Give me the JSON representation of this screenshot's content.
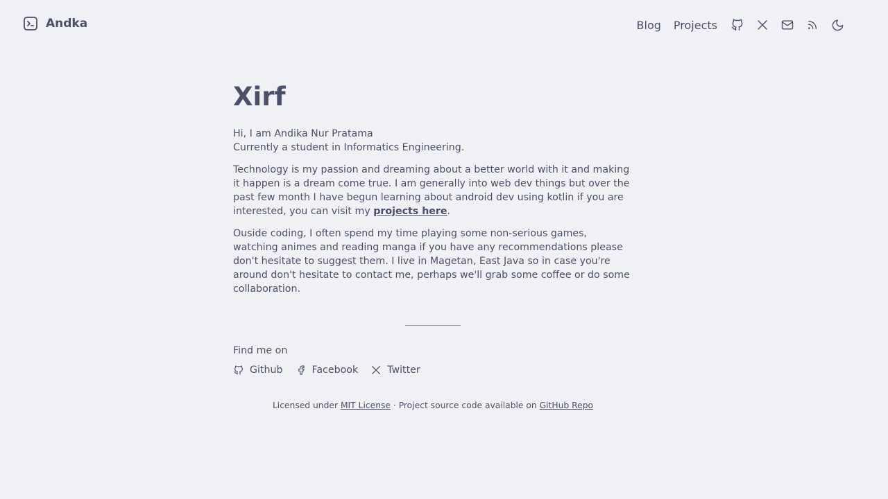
{
  "header": {
    "brand": {
      "name": "Andka",
      "icon": "terminal-icon"
    },
    "nav": {
      "links": [
        "Blog",
        "Projects"
      ],
      "icons": [
        "github-icon",
        "x-twitter-icon",
        "mail-icon",
        "rss-icon",
        "moon-icon"
      ]
    }
  },
  "main": {
    "title": "Xirf",
    "intro_line1": "Hi, I am Andika Nur Pratama",
    "intro_line2": "Currently a student in Informatics Engineering.",
    "para2_text": "Technology is my passion and dreaming about a better world with it and making it happen is a dream come true. I am generally into web dev things but over the past few month I have begun learning about android dev using kotlin if you are interested, you can visit my ",
    "para2_link": "projects here",
    "para2_end": ".",
    "para3": "Ouside coding, I often spend my time playing some non-serious games, watching animes and reading manga if you have any recommendations please don't hesitate to suggest them. I live in Magetan, East Java so in case you're around don't hesitate to contact me, perhaps we'll grab some coffee or do some collaboration.",
    "find_label": "Find me on",
    "social": [
      {
        "label": "Github",
        "icon": "github-icon"
      },
      {
        "label": "Facebook",
        "icon": "facebook-icon"
      },
      {
        "label": "Twitter",
        "icon": "x-twitter-icon"
      }
    ]
  },
  "footer": {
    "prefix": "Licensed under ",
    "license_link": "MIT License",
    "middle": " · Project source code available on ",
    "repo_link": "GitHub Repo"
  },
  "colors": {
    "background": "#eff1f5",
    "text": "#4c4f69",
    "divider": "#8c8fa1"
  }
}
